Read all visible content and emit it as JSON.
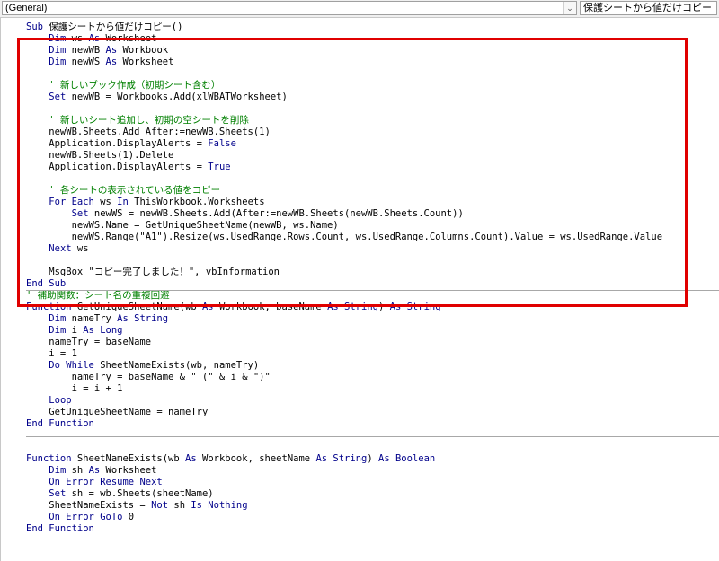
{
  "toolbar": {
    "object_combo": "(General)",
    "procedure_combo": "保護シートから値だけコピー"
  },
  "colors": {
    "keyword": "#00008b",
    "comment": "#008000",
    "text": "#000000",
    "highlight": "#e00000"
  },
  "code": {
    "lines": [
      [
        [
          "kw",
          "Sub"
        ],
        [
          "t",
          " 保護シートから値だけコピー()"
        ]
      ],
      [
        [
          "t",
          "    "
        ],
        [
          "kw",
          "Dim"
        ],
        [
          "t",
          " ws "
        ],
        [
          "kw",
          "As"
        ],
        [
          "t",
          " Worksheet"
        ]
      ],
      [
        [
          "t",
          "    "
        ],
        [
          "kw",
          "Dim"
        ],
        [
          "t",
          " newWB "
        ],
        [
          "kw",
          "As"
        ],
        [
          "t",
          " Workbook"
        ]
      ],
      [
        [
          "t",
          "    "
        ],
        [
          "kw",
          "Dim"
        ],
        [
          "t",
          " newWS "
        ],
        [
          "kw",
          "As"
        ],
        [
          "t",
          " Worksheet"
        ]
      ],
      [],
      [
        [
          "cm",
          "    ' 新しいブック作成（初期シート含む）"
        ]
      ],
      [
        [
          "t",
          "    "
        ],
        [
          "kw",
          "Set"
        ],
        [
          "t",
          " newWB = Workbooks.Add(xlWBATWorksheet)"
        ]
      ],
      [],
      [
        [
          "cm",
          "    ' 新しいシート追加し、初期の空シートを削除"
        ]
      ],
      [
        [
          "t",
          "    newWB.Sheets.Add After:=newWB.Sheets(1)"
        ]
      ],
      [
        [
          "t",
          "    Application.DisplayAlerts = "
        ],
        [
          "kw",
          "False"
        ]
      ],
      [
        [
          "t",
          "    newWB.Sheets(1).Delete"
        ]
      ],
      [
        [
          "t",
          "    Application.DisplayAlerts = "
        ],
        [
          "kw",
          "True"
        ]
      ],
      [],
      [
        [
          "cm",
          "    ' 各シートの表示されている値をコピー"
        ]
      ],
      [
        [
          "t",
          "    "
        ],
        [
          "kw",
          "For Each"
        ],
        [
          "t",
          " ws "
        ],
        [
          "kw",
          "In"
        ],
        [
          "t",
          " ThisWorkbook.Worksheets"
        ]
      ],
      [
        [
          "t",
          "        "
        ],
        [
          "kw",
          "Set"
        ],
        [
          "t",
          " newWS = newWB.Sheets.Add(After:=newWB.Sheets(newWB.Sheets.Count))"
        ]
      ],
      [
        [
          "t",
          "        newWS.Name = GetUniqueSheetName(newWB, ws.Name)"
        ]
      ],
      [
        [
          "t",
          "        newWS.Range(\"A1\").Resize(ws.UsedRange.Rows.Count, ws.UsedRange.Columns.Count).Value = ws.UsedRange.Value"
        ]
      ],
      [
        [
          "t",
          "    "
        ],
        [
          "kw",
          "Next"
        ],
        [
          "t",
          " ws"
        ]
      ],
      [],
      [
        [
          "t",
          "    MsgBox \"コピー完了しました！\", vbInformation"
        ]
      ],
      [
        [
          "kw",
          "End Sub"
        ]
      ],
      [
        [
          "cm",
          "' 補助関数：シート名の重複回避"
        ]
      ],
      [
        [
          "kw",
          "Function"
        ],
        [
          "t",
          " GetUniqueSheetName(wb "
        ],
        [
          "kw",
          "As"
        ],
        [
          "t",
          " Workbook, baseName "
        ],
        [
          "kw",
          "As String"
        ],
        [
          "t",
          ") "
        ],
        [
          "kw",
          "As String"
        ]
      ],
      [
        [
          "t",
          "    "
        ],
        [
          "kw",
          "Dim"
        ],
        [
          "t",
          " nameTry "
        ],
        [
          "kw",
          "As String"
        ]
      ],
      [
        [
          "t",
          "    "
        ],
        [
          "kw",
          "Dim"
        ],
        [
          "t",
          " i "
        ],
        [
          "kw",
          "As Long"
        ]
      ],
      [
        [
          "t",
          "    nameTry = baseName"
        ]
      ],
      [
        [
          "t",
          "    i = 1"
        ]
      ],
      [
        [
          "t",
          "    "
        ],
        [
          "kw",
          "Do While"
        ],
        [
          "t",
          " SheetNameExists(wb, nameTry)"
        ]
      ],
      [
        [
          "t",
          "        nameTry = baseName & \" (\" & i & \")\""
        ]
      ],
      [
        [
          "t",
          "        i = i + 1"
        ]
      ],
      [
        [
          "t",
          "    "
        ],
        [
          "kw",
          "Loop"
        ]
      ],
      [
        [
          "t",
          "    GetUniqueSheetName = nameTry"
        ]
      ],
      [
        [
          "kw",
          "End Function"
        ]
      ],
      [],
      [],
      [
        [
          "kw",
          "Function"
        ],
        [
          "t",
          " SheetNameExists(wb "
        ],
        [
          "kw",
          "As"
        ],
        [
          "t",
          " Workbook, sheetName "
        ],
        [
          "kw",
          "As String"
        ],
        [
          "t",
          ") "
        ],
        [
          "kw",
          "As Boolean"
        ]
      ],
      [
        [
          "t",
          "    "
        ],
        [
          "kw",
          "Dim"
        ],
        [
          "t",
          " sh "
        ],
        [
          "kw",
          "As"
        ],
        [
          "t",
          " Worksheet"
        ]
      ],
      [
        [
          "t",
          "    "
        ],
        [
          "kw",
          "On Error Resume Next"
        ]
      ],
      [
        [
          "t",
          "    "
        ],
        [
          "kw",
          "Set"
        ],
        [
          "t",
          " sh = wb.Sheets(sheetName)"
        ]
      ],
      [
        [
          "t",
          "    SheetNameExists = "
        ],
        [
          "kw",
          "Not"
        ],
        [
          "t",
          " sh "
        ],
        [
          "kw",
          "Is Nothing"
        ]
      ],
      [
        [
          "t",
          "    "
        ],
        [
          "kw",
          "On Error GoTo"
        ],
        [
          "t",
          " 0"
        ]
      ],
      [
        [
          "kw",
          "End Function"
        ]
      ]
    ]
  }
}
